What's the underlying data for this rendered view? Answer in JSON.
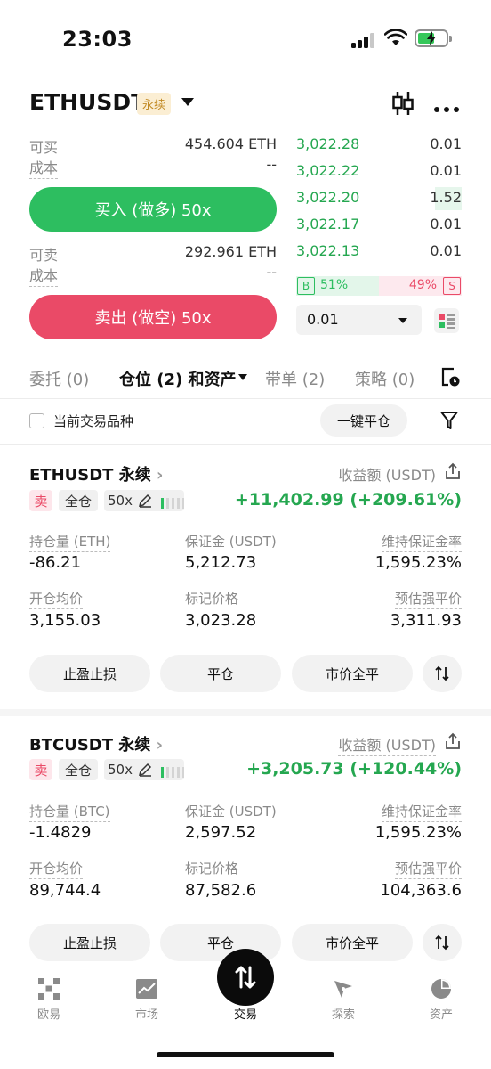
{
  "status_bar": {
    "time": "23:03"
  },
  "header": {
    "symbol": "ETHUSDT",
    "badge": "永续"
  },
  "order_panel": {
    "buy_available_label": "可买",
    "buy_available_value": "454.604 ETH",
    "buy_cost_label": "成本",
    "buy_cost_value": "--",
    "buy_button": "买入 (做多) 50x",
    "sell_available_label": "可卖",
    "sell_available_value": "292.961 ETH",
    "sell_cost_label": "成本",
    "sell_cost_value": "--",
    "sell_button": "卖出 (做空) 50x"
  },
  "order_book": {
    "rows": [
      {
        "price": "3,022.28",
        "qty": "0.01"
      },
      {
        "price": "3,022.22",
        "qty": "0.01"
      },
      {
        "price": "3,022.20",
        "qty": "1.52"
      },
      {
        "price": "3,022.17",
        "qty": "0.01"
      },
      {
        "price": "3,022.13",
        "qty": "0.01"
      }
    ],
    "buy_tag": "B",
    "buy_pct": "51%",
    "sell_pct": "49%",
    "sell_tag": "S",
    "precision": "0.01"
  },
  "tabs": [
    {
      "label": "委托 (0)"
    },
    {
      "label": "仓位 (2) 和资产"
    },
    {
      "label": "带单 (2)"
    },
    {
      "label": "策略 (0)"
    }
  ],
  "filter": {
    "current_only_label": "当前交易品种",
    "close_all_button": "一键平仓"
  },
  "positions": [
    {
      "symbol": "ETHUSDT 永续",
      "pnl_label": "收益额 (USDT)",
      "side": "卖",
      "margin_mode": "全仓",
      "leverage": "50x",
      "pnl": "+11,402.99 (+209.61%)",
      "size_label": "持仓量 (ETH)",
      "size": "-86.21",
      "margin_label": "保证金 (USDT)",
      "margin": "5,212.73",
      "mmr_label": "维持保证金率",
      "mmr": "1,595.23%",
      "entry_label": "开仓均价",
      "entry": "3,155.03",
      "mark_label": "标记价格",
      "mark": "3,023.28",
      "liq_label": "预估强平价",
      "liq": "3,311.93",
      "tpsl_button": "止盈止损",
      "close_button": "平仓",
      "market_close_button": "市价全平"
    },
    {
      "symbol": "BTCUSDT 永续",
      "pnl_label": "收益额 (USDT)",
      "side": "卖",
      "margin_mode": "全仓",
      "leverage": "50x",
      "pnl": "+3,205.73 (+120.44%)",
      "size_label": "持仓量 (BTC)",
      "size": "-1.4829",
      "margin_label": "保证金 (USDT)",
      "margin": "2,597.52",
      "mmr_label": "维持保证金率",
      "mmr": "1,595.23%",
      "entry_label": "开仓均价",
      "entry": "89,744.4",
      "mark_label": "标记价格",
      "mark": "87,582.6",
      "liq_label": "预估强平价",
      "liq": "104,363.6",
      "tpsl_button": "止盈止损",
      "close_button": "平仓",
      "market_close_button": "市价全平"
    }
  ],
  "bottom_nav": [
    {
      "label": "欧易",
      "icon": "okx-logo-icon"
    },
    {
      "label": "市场",
      "icon": "chart-icon"
    },
    {
      "label": "交易",
      "icon": "swap-vertical-icon"
    },
    {
      "label": "探索",
      "icon": "compass-icon"
    },
    {
      "label": "资产",
      "icon": "pie-chart-icon"
    }
  ],
  "colors": {
    "green": "#2dbe60",
    "red": "#ea4a67",
    "badge_bg": "#fbeed3"
  }
}
